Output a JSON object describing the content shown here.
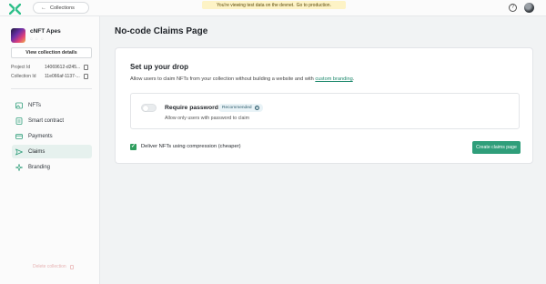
{
  "topbar": {
    "back_label": "Collections",
    "notice_text": "You're viewing test data on the devnet.",
    "notice_link": "Go to production."
  },
  "sidebar": {
    "collection_name": "cNFT Apes",
    "view_details_label": "View collection details",
    "project_id_label": "Project Id",
    "project_id_value": "14069612-d245...",
    "collection_id_label": "Collection Id",
    "collection_id_value": "11e066af-1137-...",
    "nav": [
      {
        "label": "NFTs",
        "icon": "image-icon"
      },
      {
        "label": "Smart contract",
        "icon": "contract-icon"
      },
      {
        "label": "Payments",
        "icon": "card-icon"
      },
      {
        "label": "Claims",
        "icon": "send-icon"
      },
      {
        "label": "Branding",
        "icon": "sparkle-icon"
      }
    ],
    "delete_label": "Delete collection"
  },
  "main": {
    "page_title": "No-code Claims Page",
    "card_title": "Set up your drop",
    "desc_prefix": "Allow users to claim NFTs from your collection without building a website and with",
    "desc_link": "custom branding",
    "desc_suffix": ".",
    "require_password_label": "Require password",
    "recommended_badge": "Recommended",
    "require_password_sub": "Allow only users with password to claim",
    "compression_label": "Deliver NFTs using compression (cheaper)",
    "create_button_label": "Create claims page"
  },
  "colors": {
    "accent": "#2f9e7a",
    "active_nav_bg": "#e6f1ee",
    "notice_bg": "#fdf3c6"
  }
}
